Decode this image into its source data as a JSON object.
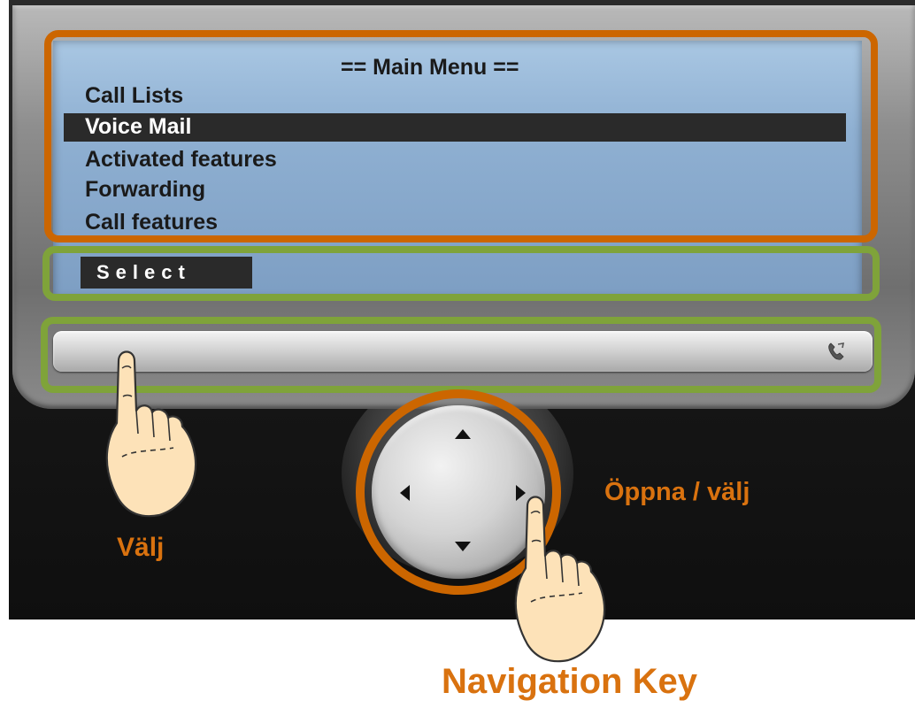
{
  "screen": {
    "title": "== Main Menu ==",
    "menu_items": [
      {
        "label": "Call Lists",
        "selected": false
      },
      {
        "label": "Voice Mail",
        "selected": true
      },
      {
        "label": "Activated features",
        "selected": false
      },
      {
        "label": "Forwarding",
        "selected": false
      },
      {
        "label": "Call features",
        "selected": false
      }
    ],
    "softkey_label": "Select"
  },
  "annotations": {
    "softkey_press": "Välj",
    "nav_press": "Öppna / välj",
    "nav_caption": "Navigation Key"
  },
  "colors": {
    "highlight_orange": "#cc6600",
    "highlight_green": "#7fa33a",
    "annotation_text": "#d9720f",
    "lcd_background": "#8fb0d2",
    "selection_bar": "#2a2a2a"
  },
  "icons": {
    "strip_right": "phone-handset-icon",
    "nav_arrows": [
      "arrow-up-icon",
      "arrow-down-icon",
      "arrow-left-icon",
      "arrow-right-icon"
    ],
    "pointers": [
      "pointing-hand-icon",
      "pointing-hand-icon"
    ]
  }
}
